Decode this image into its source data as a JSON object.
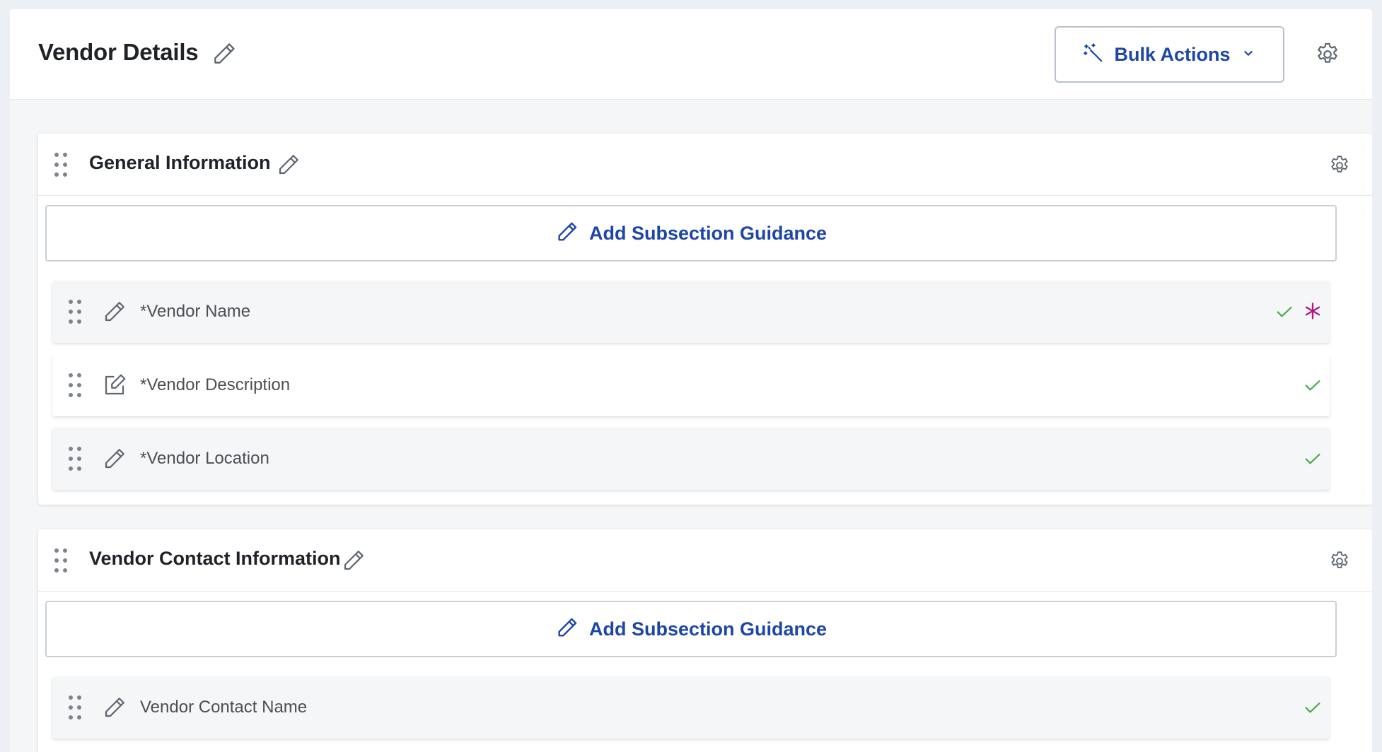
{
  "header": {
    "title": "Vendor Details",
    "bulk_actions_label": "Bulk Actions"
  },
  "colors": {
    "accent_blue": "#1d46a8",
    "check_green": "#4caf50",
    "required_magenta": "#b0177e",
    "icon_gray": "#5f6670"
  },
  "icons": {
    "title_edit": "pencil-icon",
    "bulk_actions": "magic-wand-icon",
    "bulk_dropdown": "chevron-down-icon",
    "settings": "gear-icon",
    "drag": "drag-handle-icon",
    "check": "check-icon",
    "required": "asterisk-icon",
    "edit_box": "pencil-square-icon"
  },
  "sections": [
    {
      "title": "General Information",
      "guidance_label": "Add Subsection Guidance",
      "fields": [
        {
          "label": "*Vendor Name",
          "status": "complete",
          "required_marker": true
        },
        {
          "label": "*Vendor Description",
          "status": "complete",
          "required_marker": false
        },
        {
          "label": "*Vendor Location",
          "status": "complete",
          "required_marker": false
        }
      ]
    },
    {
      "title": "Vendor Contact Information",
      "guidance_label": "Add Subsection Guidance",
      "fields": [
        {
          "label": "Vendor Contact Name",
          "status": "complete",
          "required_marker": false
        }
      ]
    }
  ]
}
